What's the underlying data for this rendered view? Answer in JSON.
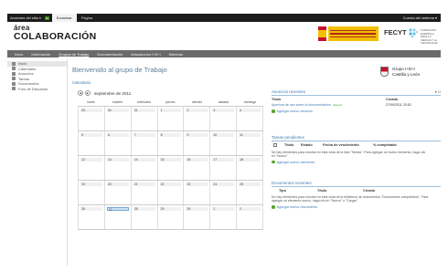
{
  "topbar": {
    "acciones": "Acciones del sitio",
    "caret": "▾",
    "tabs": [
      {
        "label": "Examinar"
      },
      {
        "label": "Página"
      }
    ],
    "cuenta": "Cuenta del sistema ▾"
  },
  "logo": {
    "line1": "área",
    "line2": "COLABORACIÓN"
  },
  "branding": {
    "ministerio": "GOBIERNO DE ESPAÑA MINISTERIO",
    "fecyt": "FECYT",
    "fecyt_sub": "FUNDACIÓN ESPAÑOLA PARA LA CIENCIA Y LA TECNOLOGÍA"
  },
  "nav": [
    "Inicio",
    "Información",
    "Grupos de Trabajo",
    "Documentación",
    "Actuaciones I+D+i",
    "Mientras"
  ],
  "sidebar": [
    {
      "label": "Inicio"
    },
    {
      "label": "Calendario"
    },
    {
      "label": "Anuncios"
    },
    {
      "label": "Tareas"
    },
    {
      "label": "Documentos"
    },
    {
      "label": "Foro de Discusión"
    }
  ],
  "page": {
    "title": "Bienvenido al grupo de Trabajo",
    "calendar_link": "Calendario",
    "month": "septiembre de 2011"
  },
  "calendar": {
    "weekdays": [
      "lunes",
      "martes",
      "miércoles",
      "jueves",
      "viernes",
      "sábado",
      "domingo"
    ],
    "weeks": [
      [
        "29",
        "30",
        "31",
        "1",
        "2",
        "3",
        "4"
      ],
      [
        "5",
        "6",
        "7",
        "8",
        "9",
        "10",
        "11"
      ],
      [
        "12",
        "13",
        "14",
        "15",
        "16",
        "17",
        "18"
      ],
      [
        "19",
        "20",
        "21",
        "22",
        "23",
        "24",
        "25"
      ],
      [
        "26",
        "27",
        "28",
        "29",
        "30",
        "1",
        "2"
      ]
    ],
    "today_week": 4,
    "today_day": 1
  },
  "group": {
    "line1": "Grupo I+D+i",
    "line2": "Castilla y León"
  },
  "anuncios": {
    "header": "Anuncios recientes",
    "ctl": "▾ ☐",
    "cols": [
      "Título",
      "Creado"
    ],
    "row": {
      "title": "Apertura de uso sobre la documentación",
      "badge": "¡Nuevo!",
      "date": "27/09/2011 20:52"
    },
    "add": "Agregar nuevo anuncio"
  },
  "tareas": {
    "header": "Tareas pendientes",
    "cols": [
      "Título",
      "Estado",
      "Fecha de vencimiento",
      "% completado"
    ],
    "msg": "No hay elementos para mostrar en esta vista de la lista \"Tareas\". Para agregar un nuevo elemento, haga clic en \"Nuevo\".",
    "add": "Agregar nuevo elemento"
  },
  "documentos": {
    "header": "Documentos recientes",
    "cols": [
      "Tipo",
      "Título",
      "Creado"
    ],
    "msg": "No hay elementos para mostrar en esta vista de la biblioteca de documentos \"Documentos compartidos\". Para agregar un elemento nuevo, haga clic en \"Nuevo\" o \"Cargar\".",
    "add": "Agregar nuevo documento"
  }
}
